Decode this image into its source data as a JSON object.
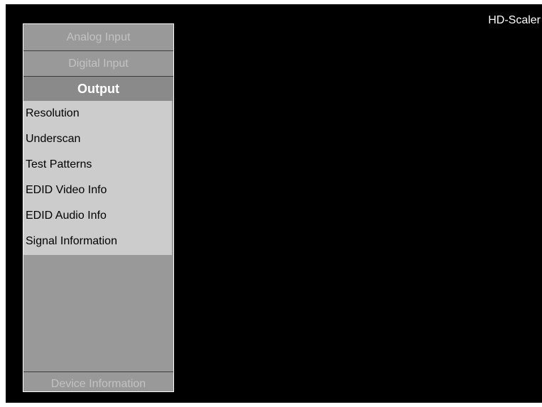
{
  "device": {
    "title": "HD-Scaler"
  },
  "menu": {
    "analog_input": "Analog Input",
    "digital_input": "Digital Input",
    "output": "Output",
    "device_information": "Device Information",
    "output_items": [
      {
        "label": "Resolution"
      },
      {
        "label": "Underscan"
      },
      {
        "label": "Test Patterns"
      },
      {
        "label": "EDID Video Info"
      },
      {
        "label": "EDID Audio Info"
      },
      {
        "label": "Signal Information"
      }
    ]
  },
  "colors": {
    "background": "#000000",
    "panel": "#999999",
    "submenu": "#cccccc",
    "inactive_text": "#c2c2c2",
    "active_text": "#ffffff"
  }
}
